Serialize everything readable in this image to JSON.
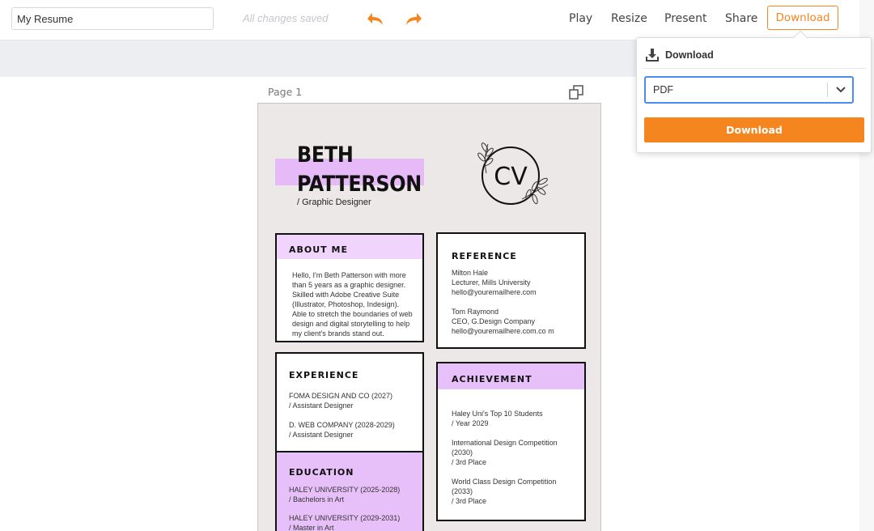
{
  "toolbar": {
    "title_value": "My Resume",
    "saved_status": "All changes saved",
    "nav": {
      "play": "Play",
      "resize": "Resize",
      "present": "Present",
      "share": "Share",
      "download": "Download"
    }
  },
  "canvas": {
    "page_label": "Page 1"
  },
  "resume": {
    "name_line1": "BETH",
    "name_line2": "PATTERSON",
    "role": "/ Graphic Designer",
    "logo_text": "CV",
    "about": {
      "heading": "ABOUT ME",
      "text": "Hello, I'm Beth Patterson with more than 5 years as a graphic designer. Skilled with Adobe Creative Suite (Illustrator, Photoshop, Indesign). Able to stretch the boundaries of web design and digital storytelling to help my client's brands stand out."
    },
    "reference": {
      "heading": "REFERENCE",
      "r1": {
        "name": "Milton Hale",
        "title": "Lecturer, Mills University",
        "email": "hello@youremailhere.com"
      },
      "r2": {
        "name": "Tom Raymond",
        "title": "CEO, G.Design Company",
        "email": "hello@youremailhere.com.co m"
      }
    },
    "experience": {
      "heading": "EXPERIENCE",
      "e1": {
        "company": "FOMA DESIGN AND CO (2027)",
        "role": "/ Assistant Designer"
      },
      "e2": {
        "company": "D. WEB COMPANY (2028-2029)",
        "role": "/ Assistant Designer"
      }
    },
    "education": {
      "heading": "EDUCATION",
      "d1": {
        "school": "HALEY UNIVERSITY (2025-2028)",
        "degree": "/ Bachelors in Art"
      },
      "d2": {
        "school": "HALEY UNIVERSITY (2029-2031)",
        "degree": "/ Master in Art"
      }
    },
    "achievement": {
      "heading": "ACHIEVEMENT",
      "a1": {
        "title": "Haley Uni's Top 10 Students",
        "detail": "/ Year 2029"
      },
      "a2": {
        "title": "International Design Competition (2030)",
        "detail": "/ 3rd Place"
      },
      "a3": {
        "title": "World Class Design Competition (2033)",
        "detail": "/ 3rd Place"
      }
    }
  },
  "download_panel": {
    "title": "Download",
    "format": "PDF",
    "button": "Download"
  },
  "colors": {
    "accent": "#f5861f",
    "select_border": "#4a8cf0",
    "highlight_purple": "#e7c0f9",
    "page_bg": "#ece8e7"
  },
  "icons": [
    "undo-icon",
    "redo-icon",
    "copy-page-icon",
    "download-icon",
    "chevron-down-icon"
  ]
}
